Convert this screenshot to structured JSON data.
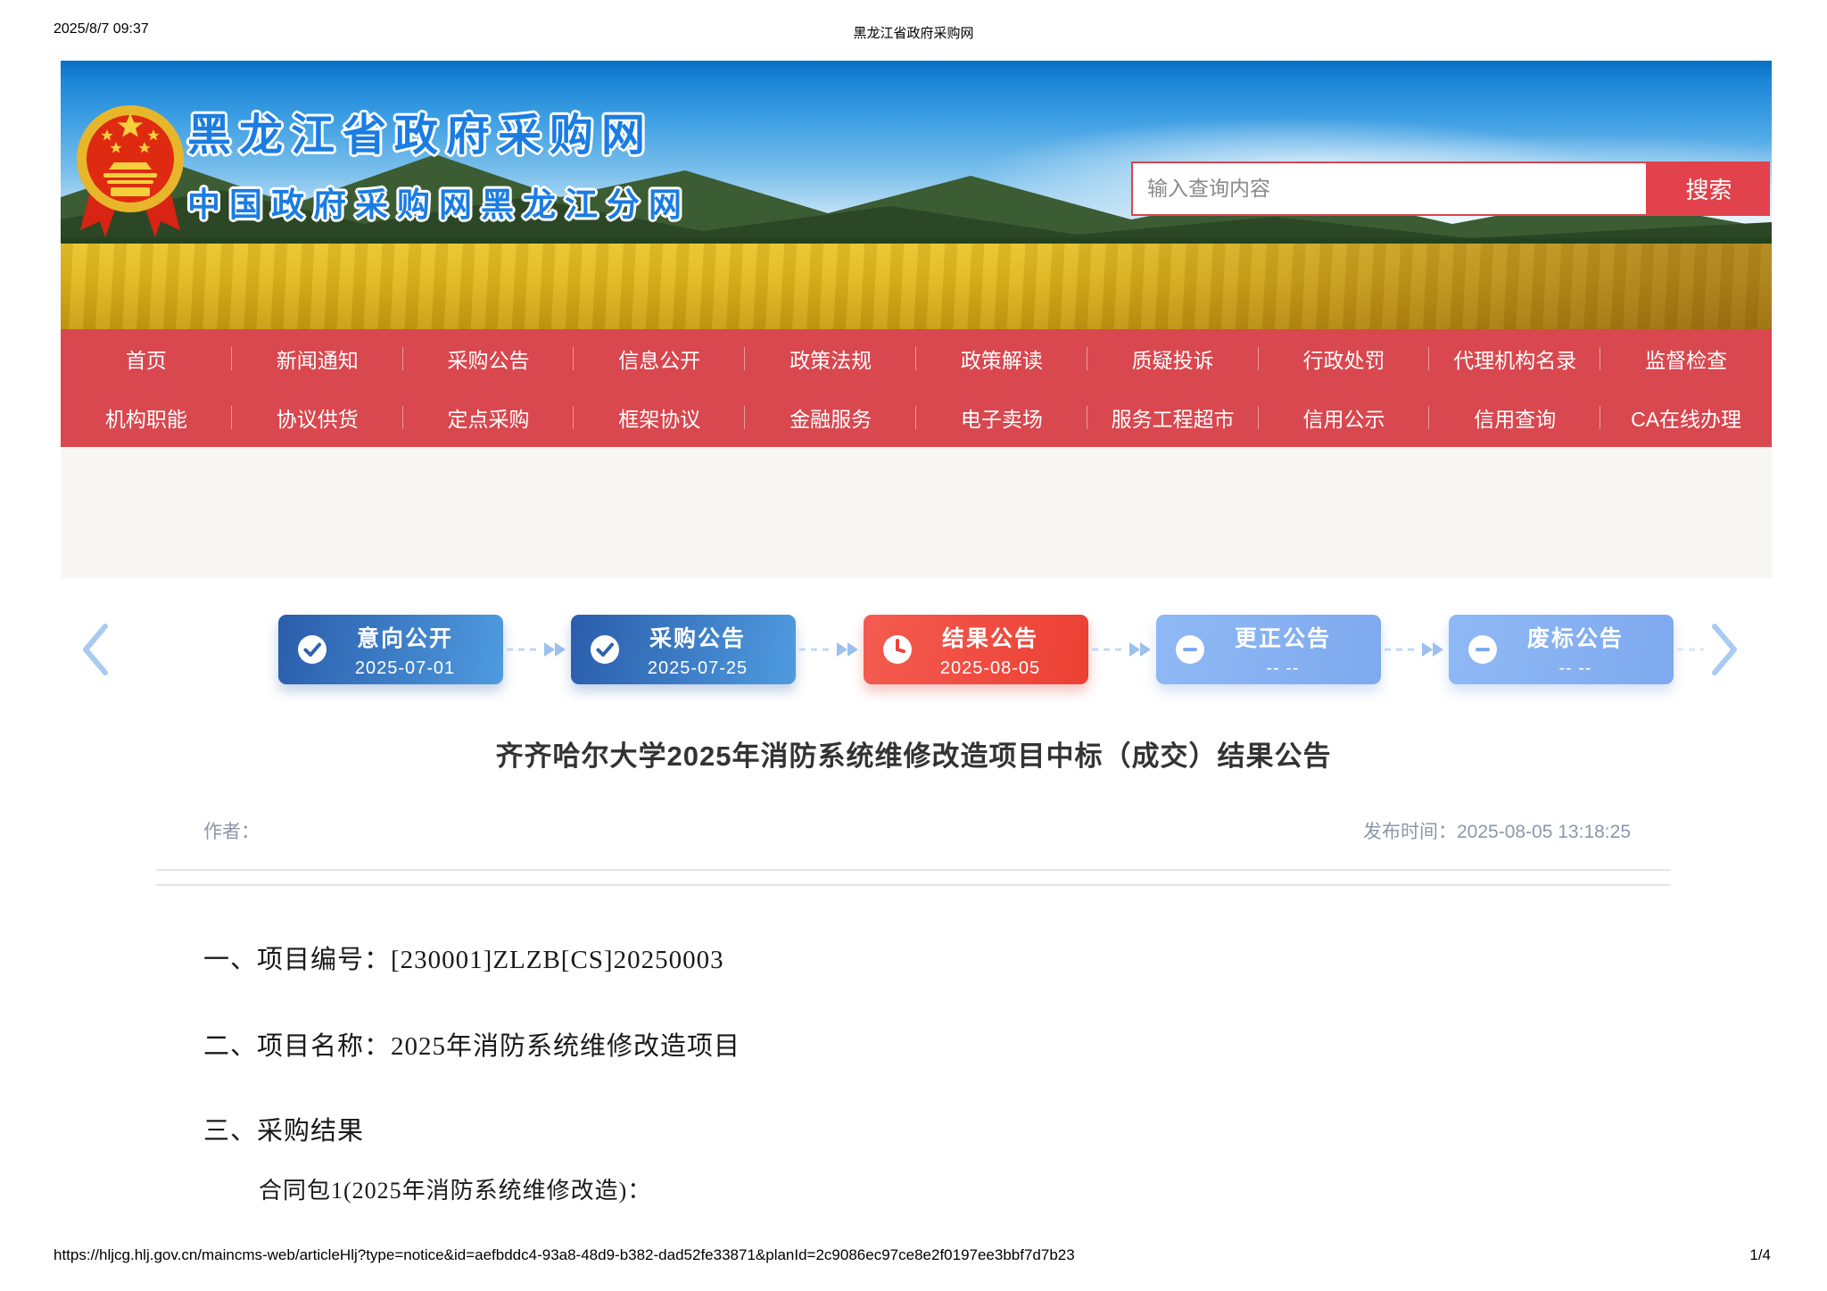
{
  "print_header": {
    "timestamp": "2025/8/7 09:37",
    "page_title": "黑龙江省政府采购网"
  },
  "banner": {
    "site_title": "黑龙江省政府采购网",
    "site_subtitle": "中国政府采购网黑龙江分网",
    "logo": "china-national-emblem",
    "search": {
      "placeholder": "输入查询内容",
      "button_label": "搜索"
    }
  },
  "nav": {
    "row1": [
      "首页",
      "新闻通知",
      "采购公告",
      "信息公开",
      "政策法规",
      "政策解读",
      "质疑投诉",
      "行政处罚",
      "代理机构名录",
      "监督检查"
    ],
    "row2": [
      "机构职能",
      "协议供货",
      "定点采购",
      "框架协议",
      "金融服务",
      "电子卖场",
      "服务工程超市",
      "信用公示",
      "信用查询",
      "CA在线办理"
    ]
  },
  "timeline": {
    "steps": [
      {
        "label": "意向公开",
        "date": "2025-07-01",
        "icon": "check-circle",
        "state": "done"
      },
      {
        "label": "采购公告",
        "date": "2025-07-25",
        "icon": "check-circle",
        "state": "done"
      },
      {
        "label": "结果公告",
        "date": "2025-08-05",
        "icon": "clock",
        "state": "current"
      },
      {
        "label": "更正公告",
        "date": "-- --",
        "icon": "minus-circle",
        "state": "pending"
      },
      {
        "label": "废标公告",
        "date": "-- --",
        "icon": "minus-circle",
        "state": "pending"
      }
    ]
  },
  "article": {
    "title": "齐齐哈尔大学2025年消防系统维修改造项目中标（成交）结果公告",
    "author_label": "作者：",
    "publish_label": "发布时间：",
    "publish_time": "2025-08-05 13:18:25",
    "paragraphs": [
      "一、项目编号：[230001]ZLZB[CS]20250003",
      "二、项目名称：2025年消防系统维修改造项目",
      "三、采购结果",
      "合同包1(2025年消防系统维修改造)："
    ]
  },
  "footer": {
    "url": "https://hljcg.hlj.gov.cn/maincms-web/articleHlj?type=notice&id=aefbddc4-93a8-48d9-b382-dad52fe33871&planId=2c9086ec97ce8e2f0197ee3bbf7d7b23",
    "page_number": "1/4"
  },
  "colors": {
    "nav_red": "#d9474f",
    "accent_red": "#e2424b",
    "step_blue": "#2f66b2",
    "step_red": "#ee4438",
    "step_lightblue": "#7fa9ef",
    "title_blue": "#1b7ce2"
  }
}
